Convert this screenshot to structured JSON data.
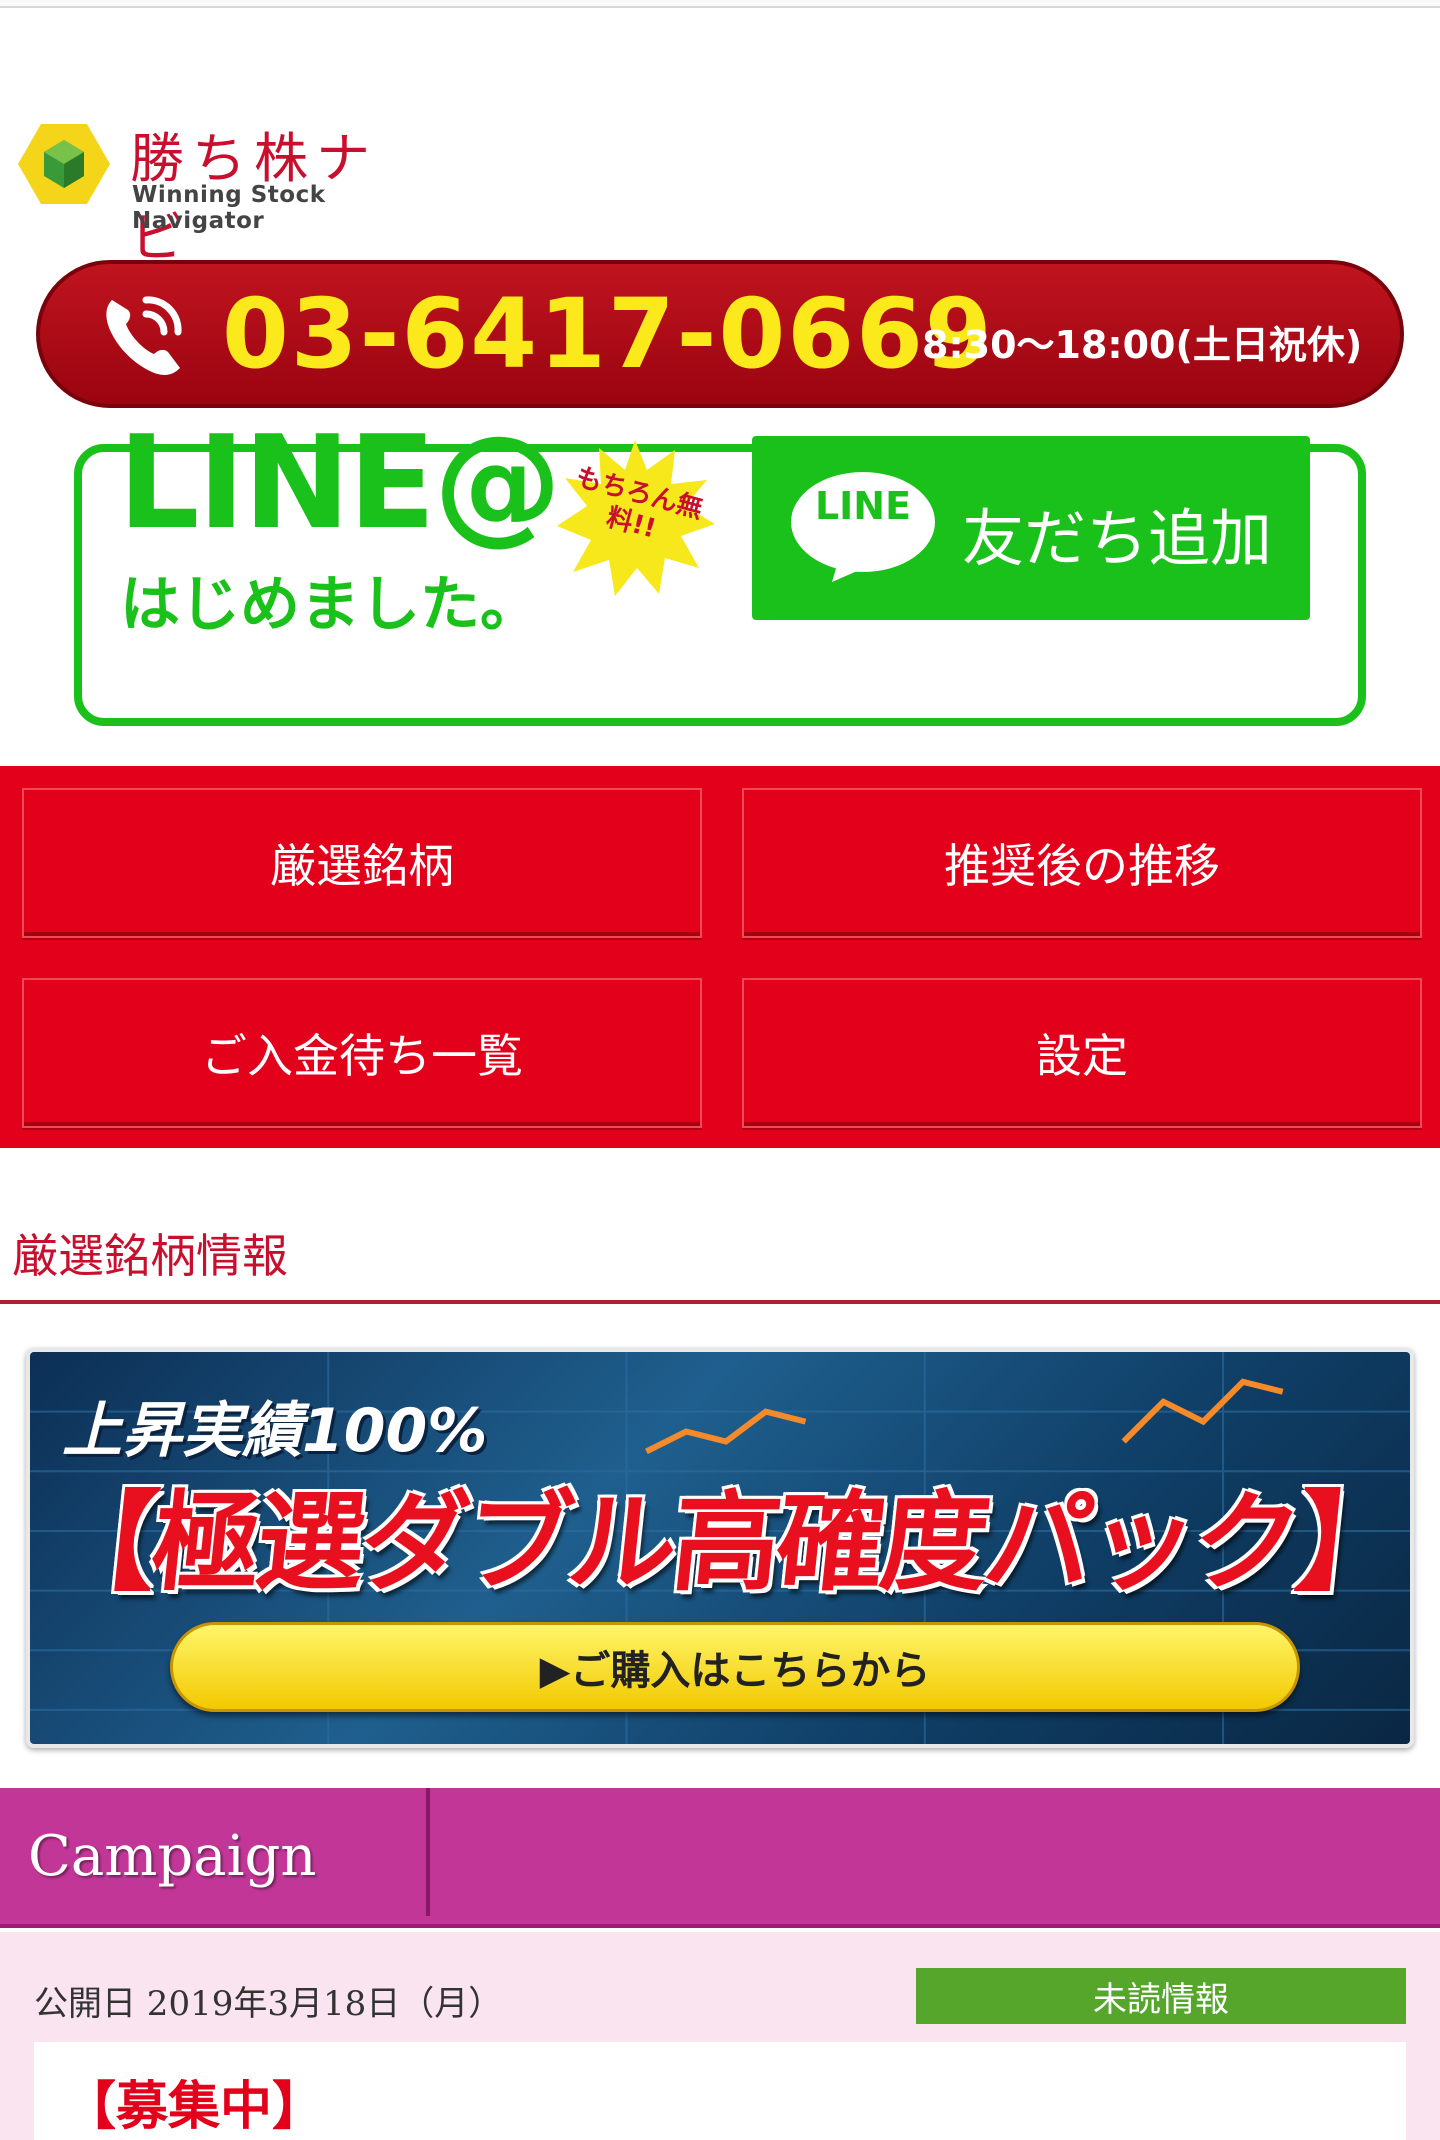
{
  "logo": {
    "title": "勝ち株ナビ",
    "subtitle": "Winning Stock Navigator"
  },
  "phone": {
    "number": "03-6417-0669",
    "hours": "8:30〜18:00(土日祝休)"
  },
  "line": {
    "headline": "LINE@",
    "tagline": "はじめました。",
    "burst": "もちろん無料!!",
    "button_icon_text": "LINE",
    "button_label": "友だち追加"
  },
  "nav": {
    "items": [
      {
        "label": "厳選銘柄"
      },
      {
        "label": "推奨後の推移"
      },
      {
        "label": "ご入金待ち一覧"
      },
      {
        "label": "設定"
      }
    ]
  },
  "section": {
    "title": "厳選銘柄情報"
  },
  "promo": {
    "subtitle": "上昇実績100%",
    "title": "【極選ダブル高確度パック】",
    "button": "▶ご購入はこちらから"
  },
  "campaign": {
    "label": "Campaign"
  },
  "entry": {
    "date": "公開日 2019年3月18日（月）",
    "badge": "未読情報",
    "title": "【募集中】"
  },
  "colors": {
    "brand_red": "#e2001a",
    "line_green": "#1bc11b",
    "campaign_magenta": "#c23698",
    "phone_yellow": "#fbe91c"
  }
}
